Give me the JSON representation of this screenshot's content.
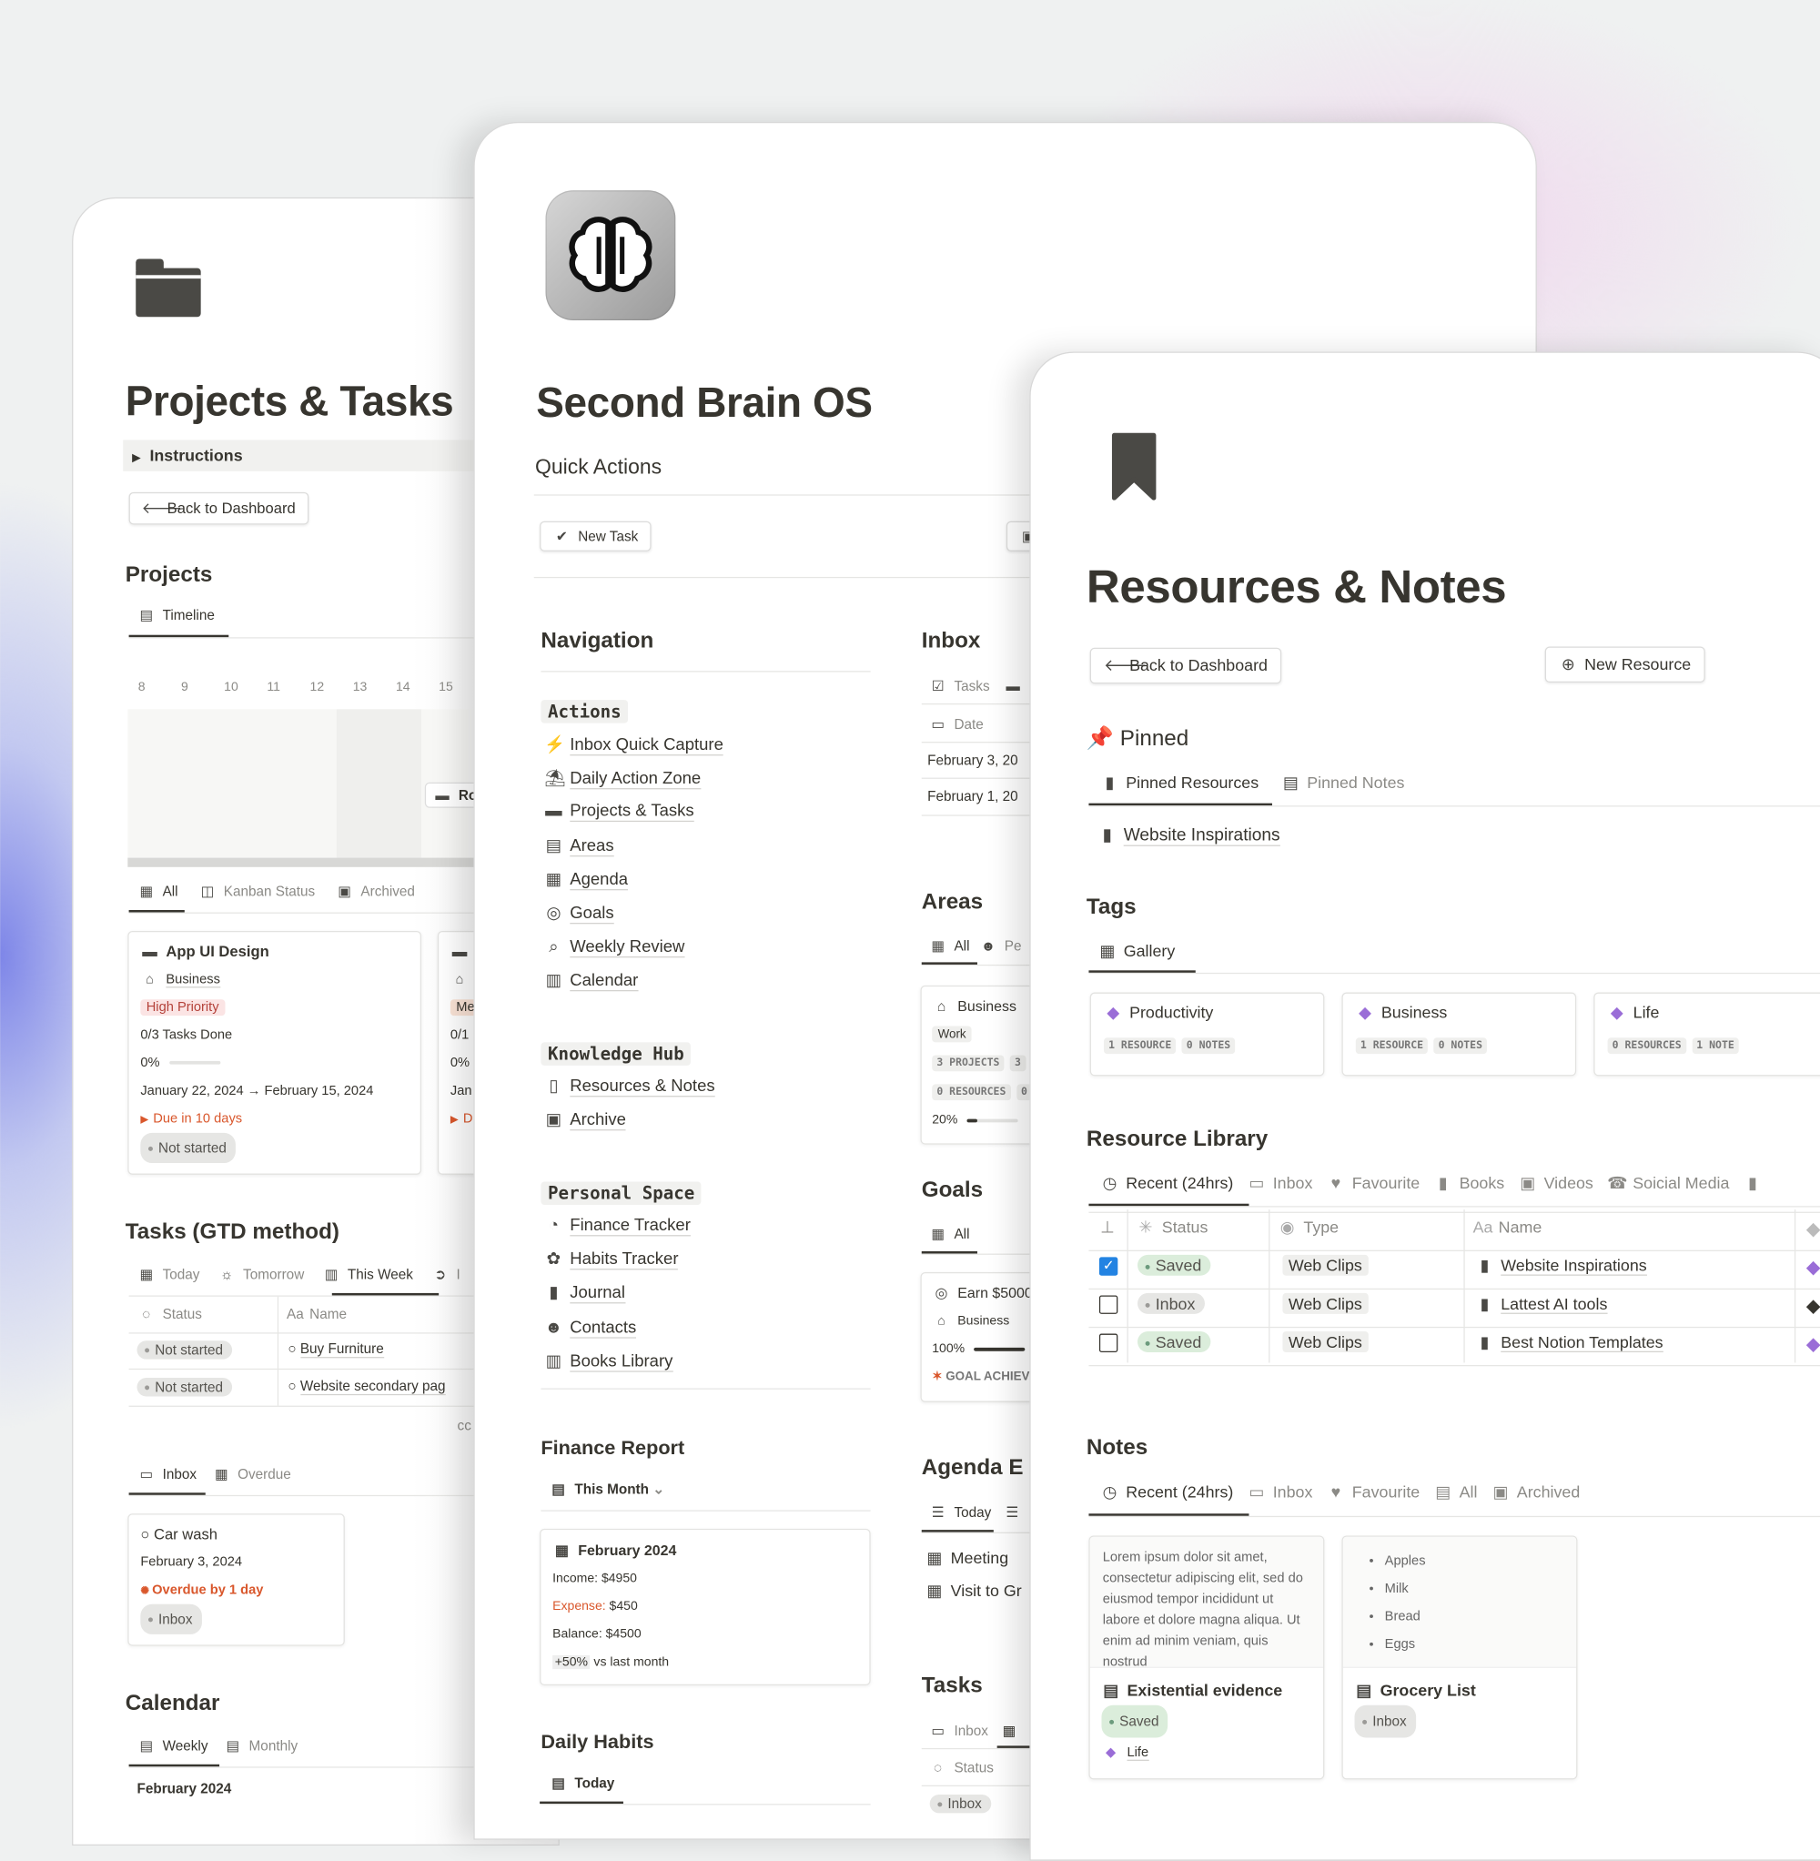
{
  "projects_tasks": {
    "title": "Projects & Tasks",
    "instructions": "Instructions",
    "back": "Back to Dashboard",
    "projects_heading": "Projects",
    "timeline_tab": "Timeline",
    "timeline_days": [
      "8",
      "9",
      "10",
      "11",
      "12",
      "13",
      "14",
      "15"
    ],
    "timeline_item": "Ro",
    "views": [
      "All",
      "Kanban Status",
      "Archived"
    ],
    "card": {
      "name": "App UI Design",
      "area": "Business",
      "priority": "High Priority",
      "tasks_done": "0/3 Tasks Done",
      "progress_label": "0%",
      "progress": 0,
      "dates": "January 22, 2024 → February 15, 2024",
      "due": "Due in 10 days",
      "status": "Not started"
    },
    "card2": {
      "priority": "Me",
      "tasks_done": "0/1",
      "progress_label": "0%",
      "dates": "Jan",
      "due": "D"
    },
    "tasks_heading": "Tasks (GTD method)",
    "task_tabs": [
      "Today",
      "Tomorrow",
      "This Week",
      "I"
    ],
    "task_columns": [
      "Status",
      "Name"
    ],
    "tasks": [
      {
        "status": "Not started",
        "name": "Buy Furniture"
      },
      {
        "status": "Not started",
        "name": "Website secondary pag"
      }
    ],
    "more": "cc",
    "inbox_tabs": [
      "Inbox",
      "Overdue"
    ],
    "inbox_card": {
      "name": "Car wash",
      "date": "February 3, 2024",
      "overdue": "Overdue by 1 day",
      "status": "Inbox"
    },
    "calendar_heading": "Calendar",
    "calendar_tabs": [
      "Weekly",
      "Monthly"
    ],
    "calendar_month": "February 2024"
  },
  "second_brain": {
    "title": "Second Brain OS",
    "quick_actions": "Quick Actions",
    "new_task": "New Task",
    "navigation": "Navigation",
    "groups": [
      {
        "label": "Actions",
        "items": [
          "Inbox Quick Capture",
          "Daily Action Zone",
          "Projects & Tasks",
          "Areas",
          "Agenda",
          "Goals",
          "Weekly Review",
          "Calendar"
        ]
      },
      {
        "label": "Knowledge Hub",
        "items": [
          "Resources & Notes",
          "Archive"
        ]
      },
      {
        "label": "Personal Space",
        "items": [
          "Finance Tracker",
          "Habits Tracker",
          "Journal",
          "Contacts",
          "Books Library"
        ]
      }
    ],
    "finance": {
      "heading": "Finance Report",
      "tab": "This Month",
      "month": "February 2024",
      "income": "Income: $4950",
      "expense_label": "Expense:",
      "expense": " $450",
      "balance": "Balance: $4500",
      "change": "+50%",
      "change_suffix": " vs last month"
    },
    "habits": {
      "heading": "Daily Habits",
      "tab": "Today"
    },
    "inbox": {
      "heading": "Inbox",
      "tabs": [
        "Tasks",
        ""
      ],
      "column": "Date",
      "rows": [
        "February 3, 20",
        "February 1, 20"
      ]
    },
    "areas": {
      "heading": "Areas",
      "tabs": [
        "All",
        "Pe"
      ],
      "card": {
        "name": "Business",
        "tag": "Work",
        "projects": "3 PROJECTS",
        "projects_more": "3 ",
        "resources": "0 RESOURCES",
        "resources_more": "0",
        "progress_label": "20%",
        "progress": 20
      }
    },
    "goals": {
      "heading": "Goals",
      "tab": "All",
      "card": {
        "name": "Earn $5000",
        "area": "Business",
        "progress_label": "100%",
        "progress": 100,
        "badge": "GOAL ACHIEVED"
      }
    },
    "agenda": {
      "heading": "Agenda E",
      "tabs": [
        "Today",
        ""
      ],
      "items": [
        "Meeting",
        "Visit to Gr"
      ]
    },
    "tasks": {
      "heading": "Tasks",
      "tabs": [
        "Inbox",
        ""
      ],
      "column": "Status",
      "status": "Inbox"
    }
  },
  "resources": {
    "title": "Resources & Notes",
    "back": "Back to Dashboard",
    "new_resource": "New Resource",
    "pinned": "Pinned",
    "pinned_tabs": [
      "Pinned Resources",
      "Pinned Notes"
    ],
    "pinned_item": "Website Inspirations",
    "tags_heading": "Tags",
    "tags_tab": "Gallery",
    "tags": [
      {
        "name": "Productivity",
        "a": "1 RESOURCE",
        "b": "0 NOTES"
      },
      {
        "name": "Business",
        "a": "1 RESOURCE",
        "b": "0 NOTES"
      },
      {
        "name": "Life",
        "a": "0 RESOURCES",
        "b": "1 NOTE"
      }
    ],
    "library_heading": "Resource Library",
    "library_tabs": [
      "Recent (24hrs)",
      "Inbox",
      "Favourite",
      "Books",
      "Videos",
      "Soicial Media"
    ],
    "columns": [
      "Status",
      "Type",
      "Name"
    ],
    "rows": [
      {
        "checked": true,
        "status": "Saved",
        "type": "Web Clips",
        "name": "Website Inspirations",
        "tag_color": "#9a6dd7"
      },
      {
        "checked": false,
        "status": "Inbox",
        "type": "Web Clips",
        "name": "Lattest AI tools",
        "tag_color": "#37352f"
      },
      {
        "checked": false,
        "status": "Saved",
        "type": "Web Clips",
        "name": "Best Notion Templates",
        "tag_color": "#9a6dd7"
      }
    ],
    "notes_heading": "Notes",
    "notes_tabs": [
      "Recent (24hrs)",
      "Inbox",
      "Favourite",
      "All",
      "Archived"
    ],
    "notes": [
      {
        "preview": "Lorem ipsum dolor sit amet, consectetur adipiscing elit, sed do eiusmod tempor incididunt ut labore et dolore magna aliqua. Ut enim ad minim veniam, quis nostrud",
        "name": "Existential evidence",
        "status": "Saved",
        "tag": "Life"
      },
      {
        "list": [
          "Apples",
          "Milk",
          "Bread",
          "Eggs"
        ],
        "name": "Grocery List",
        "status": "Inbox"
      }
    ],
    "accent": "#2383e2",
    "tag_color": "#9a6dd7"
  }
}
